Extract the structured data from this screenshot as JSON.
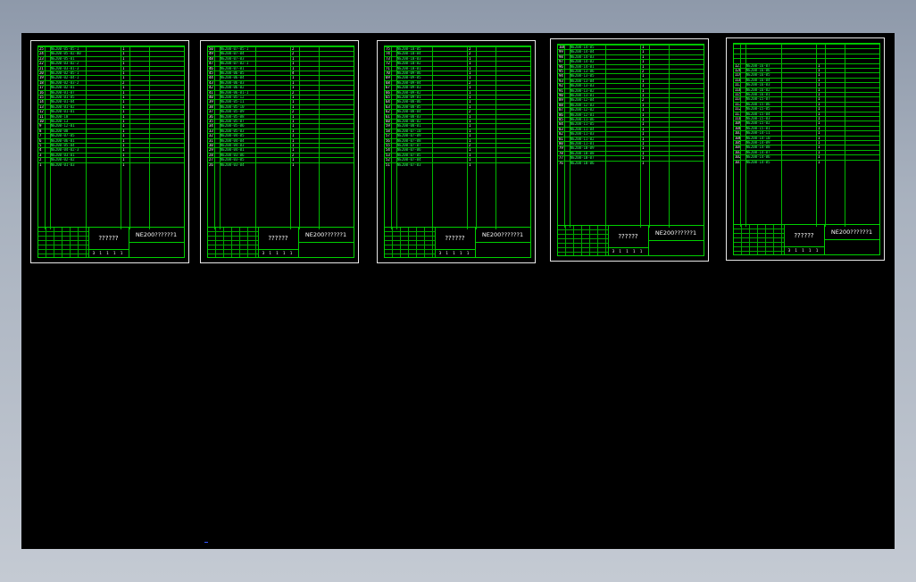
{
  "colors": {
    "background_top": "#8e99aa",
    "background_bottom": "#c4cad3",
    "model_space": "#000000",
    "sheet_border": "#e8e8e8",
    "frame_line": "#00d000",
    "text_code": "#33ff66",
    "text_name": "#2f9fff",
    "text_plain": "#ffffff"
  },
  "sheets": [
    {
      "center_label": "??????",
      "drawing_code": "NE200??????1",
      "bottom_marks": "3 1 1 1 1",
      "rows": [
        [
          "25",
          "",
          "NE200-05-05-1",
          "",
          "1",
          "",
          "",
          ""
        ],
        [
          "24",
          "",
          "NE200-05-02-00",
          "",
          "1",
          "",
          "",
          ""
        ],
        [
          "23",
          "",
          "NE200-05-01",
          "",
          "1",
          "",
          "",
          ""
        ],
        [
          "22",
          "",
          "NE200-03-02-2",
          "",
          "1",
          "",
          "",
          ""
        ],
        [
          "21",
          "",
          "NE200-03-01-3",
          "",
          "1",
          "",
          "",
          ""
        ],
        [
          "20",
          "",
          "NE200-02-05-1",
          "",
          "1",
          "",
          "",
          ""
        ],
        [
          "19",
          "",
          "NE200-02-04-1",
          "",
          "1",
          "",
          "",
          ""
        ],
        [
          "18",
          "",
          "NE200-02-03-2",
          "",
          "2",
          "",
          "",
          ""
        ],
        [
          "17",
          "",
          "NE200-02-01",
          "",
          "1",
          "",
          "",
          ""
        ],
        [
          "16",
          "",
          "NE200-01-07",
          "",
          "1",
          "",
          "",
          ""
        ],
        [
          "15",
          "",
          "NE200-01-05",
          "",
          "1",
          "",
          "",
          ""
        ],
        [
          "14",
          "",
          "NE200-01-04",
          "",
          "1",
          "",
          "",
          ""
        ],
        [
          "13",
          "",
          "NE200-01-02",
          "",
          "1",
          "",
          "",
          ""
        ],
        [
          "12",
          "",
          "NE200-01-01",
          "",
          "1",
          "",
          "",
          ""
        ],
        [
          "11",
          "",
          "NE200-18",
          "",
          "1",
          "",
          "",
          ""
        ],
        [
          "10",
          "",
          "NE200-13",
          "",
          "1",
          "",
          "",
          ""
        ],
        [
          "9",
          "",
          "NE200-12-01",
          "",
          "1",
          "",
          "",
          ""
        ],
        [
          "8",
          "",
          "NE200-08",
          "",
          "1",
          "",
          "",
          ""
        ],
        [
          "7",
          "",
          "NE200-07-05",
          "",
          "1",
          "",
          "",
          ""
        ],
        [
          "6",
          "",
          "NE200-06-01",
          "",
          "1",
          "",
          "",
          ""
        ],
        [
          "5",
          "",
          "NE200-05-04",
          "",
          "1",
          "",
          "",
          ""
        ],
        [
          "4",
          "",
          "NE200-04-02-3",
          "",
          "1",
          "",
          "",
          ""
        ],
        [
          "3",
          "",
          "NE200-03-01",
          "",
          "1",
          "",
          "",
          ""
        ],
        [
          "2",
          "",
          "NE200-02-02",
          "",
          "1",
          "",
          "",
          ""
        ],
        [
          "1",
          "",
          "NE200-01-03",
          "",
          "1",
          "",
          "",
          ""
        ]
      ]
    },
    {
      "center_label": "??????",
      "drawing_code": "NE200??????1",
      "bottom_marks": "3 1 1 1 1",
      "rows": [
        [
          "50",
          "",
          "NE200-07-05-1",
          "",
          "2",
          "",
          "",
          ""
        ],
        [
          "49",
          "",
          "NE200-07-04",
          "",
          "2",
          "",
          "",
          ""
        ],
        [
          "48",
          "",
          "NE200-07-03",
          "",
          "1",
          "",
          "",
          ""
        ],
        [
          "47",
          "",
          "NE200-07-02-1",
          "",
          "1",
          "",
          "",
          ""
        ],
        [
          "46",
          "",
          "NE200-07-01",
          "",
          "1",
          "",
          "",
          ""
        ],
        [
          "45",
          "",
          "NE200-06-05",
          "",
          "4",
          "",
          "",
          ""
        ],
        [
          "44",
          "",
          "NE200-06-04",
          "",
          "1",
          "",
          "",
          ""
        ],
        [
          "43",
          "",
          "NE200-06-03",
          "",
          "1",
          "",
          "",
          ""
        ],
        [
          "42",
          "",
          "NE200-06-02",
          "",
          "1",
          "",
          "",
          ""
        ],
        [
          "41",
          "",
          "NE200-06-01-1",
          "",
          "2",
          "",
          "",
          ""
        ],
        [
          "40",
          "",
          "NE200-05-12",
          "",
          "1",
          "",
          "",
          ""
        ],
        [
          "39",
          "",
          "NE200-05-11",
          "",
          "1",
          "",
          "",
          ""
        ],
        [
          "38",
          "",
          "NE200-05-10",
          "",
          "1",
          "",
          "",
          ""
        ],
        [
          "37",
          "",
          "NE200-05-09",
          "",
          "2",
          "",
          "",
          ""
        ],
        [
          "36",
          "",
          "NE200-05-08",
          "",
          "1",
          "",
          "",
          ""
        ],
        [
          "35",
          "",
          "NE200-05-07",
          "",
          "1",
          "",
          "",
          ""
        ],
        [
          "34",
          "",
          "NE200-05-06",
          "",
          "1",
          "",
          "",
          ""
        ],
        [
          "33",
          "",
          "NE200-05-03",
          "",
          "1",
          "",
          "",
          ""
        ],
        [
          "32",
          "",
          "NE200-04-05",
          "",
          "1",
          "",
          "",
          ""
        ],
        [
          "31",
          "",
          "NE200-04-04",
          "",
          "1",
          "",
          "",
          ""
        ],
        [
          "30",
          "",
          "NE200-04-03",
          "",
          "1",
          "",
          "",
          ""
        ],
        [
          "29",
          "",
          "NE200-04-01",
          "",
          "1",
          "",
          "",
          ""
        ],
        [
          "28",
          "",
          "NE200-03-06",
          "",
          "2",
          "",
          "",
          ""
        ],
        [
          "27",
          "",
          "NE200-03-05",
          "",
          "1",
          "",
          "",
          ""
        ],
        [
          "26",
          "",
          "NE200-03-04",
          "",
          "1",
          "",
          "",
          ""
        ]
      ]
    },
    {
      "center_label": "??????",
      "drawing_code": "NE200??????1",
      "bottom_marks": "3 1 1 1 1",
      "rows": [
        [
          "75",
          "",
          "NE200-10-05",
          "",
          "2",
          "",
          "",
          ""
        ],
        [
          "74",
          "",
          "NE200-10-04",
          "",
          "2",
          "",
          "",
          ""
        ],
        [
          "73",
          "",
          "NE200-10-03",
          "",
          "1",
          "",
          "",
          ""
        ],
        [
          "72",
          "",
          "NE200-10-02",
          "",
          "1",
          "",
          "",
          ""
        ],
        [
          "71",
          "",
          "NE200-10-01",
          "",
          "1",
          "",
          "",
          ""
        ],
        [
          "70",
          "",
          "NE200-09-06",
          "",
          "1",
          "",
          "",
          ""
        ],
        [
          "69",
          "",
          "NE200-09-05",
          "",
          "1",
          "",
          "",
          ""
        ],
        [
          "68",
          "",
          "NE200-09-04",
          "",
          "2",
          "",
          "",
          ""
        ],
        [
          "67",
          "",
          "NE200-09-03",
          "",
          "1",
          "",
          "",
          ""
        ],
        [
          "66",
          "",
          "NE200-09-02",
          "",
          "1",
          "",
          "",
          ""
        ],
        [
          "65",
          "",
          "NE200-09-01",
          "",
          "1",
          "",
          "",
          ""
        ],
        [
          "64",
          "",
          "NE200-08-06",
          "",
          "1",
          "",
          "",
          ""
        ],
        [
          "63",
          "",
          "NE200-08-05",
          "",
          "1",
          "",
          "",
          ""
        ],
        [
          "62",
          "",
          "NE200-08-04",
          "",
          "2",
          "",
          "",
          ""
        ],
        [
          "61",
          "",
          "NE200-08-03",
          "",
          "1",
          "",
          "",
          ""
        ],
        [
          "60",
          "",
          "NE200-08-02",
          "",
          "1",
          "",
          "",
          ""
        ],
        [
          "59",
          "",
          "NE200-08-01",
          "",
          "1",
          "",
          "",
          ""
        ],
        [
          "58",
          "",
          "NE200-07-10",
          "",
          "1",
          "",
          "",
          ""
        ],
        [
          "57",
          "",
          "NE200-07-09",
          "",
          "1",
          "",
          "",
          ""
        ],
        [
          "56",
          "",
          "NE200-07-08",
          "",
          "1",
          "",
          "",
          ""
        ],
        [
          "55",
          "",
          "NE200-07-07",
          "",
          "2",
          "",
          "",
          ""
        ],
        [
          "54",
          "",
          "NE200-07-06",
          "",
          "1",
          "",
          "",
          ""
        ],
        [
          "53",
          "",
          "NE200-07-05",
          "",
          "1",
          "",
          "",
          ""
        ],
        [
          "52",
          "",
          "NE200-07-04",
          "",
          "1",
          "",
          "",
          ""
        ],
        [
          "51",
          "",
          "NE200-07-03",
          "",
          "1",
          "",
          "",
          ""
        ]
      ]
    },
    {
      "center_label": "??????",
      "drawing_code": "NE200??????1",
      "bottom_marks": "3 1 1 1 1",
      "rows": [
        [
          "100",
          "",
          "NE200-14-05",
          "",
          "1",
          "",
          "",
          ""
        ],
        [
          "99",
          "",
          "NE200-14-04",
          "",
          "1",
          "",
          "",
          ""
        ],
        [
          "98",
          "",
          "NE200-14-03",
          "",
          "1",
          "",
          "",
          ""
        ],
        [
          "97",
          "",
          "NE200-14-02",
          "",
          "1",
          "",
          "",
          ""
        ],
        [
          "96",
          "",
          "NE200-14-01",
          "",
          "1",
          "",
          "",
          ""
        ],
        [
          "95",
          "",
          "NE200-13-06",
          "",
          "2",
          "",
          "",
          ""
        ],
        [
          "94",
          "",
          "NE200-13-05",
          "",
          "1",
          "",
          "",
          ""
        ],
        [
          "93",
          "",
          "NE200-13-04",
          "",
          "1",
          "",
          "",
          ""
        ],
        [
          "92",
          "",
          "NE200-13-03",
          "",
          "1",
          "",
          "",
          ""
        ],
        [
          "91",
          "",
          "NE200-13-02",
          "",
          "1",
          "",
          "",
          ""
        ],
        [
          "90",
          "",
          "NE200-13-01",
          "",
          "1",
          "",
          "",
          ""
        ],
        [
          "89",
          "",
          "NE200-12-04",
          "",
          "2",
          "",
          "",
          ""
        ],
        [
          "88",
          "",
          "NE200-12-03",
          "",
          "1",
          "",
          "",
          ""
        ],
        [
          "87",
          "",
          "NE200-12-02",
          "",
          "1",
          "",
          "",
          ""
        ],
        [
          "86",
          "",
          "NE200-12-01",
          "",
          "1",
          "",
          "",
          ""
        ],
        [
          "85",
          "",
          "NE200-11-06",
          "",
          "1",
          "",
          "",
          ""
        ],
        [
          "84",
          "",
          "NE200-11-05",
          "",
          "1",
          "",
          "",
          ""
        ],
        [
          "83",
          "",
          "NE200-11-04",
          "",
          "1",
          "",
          "",
          ""
        ],
        [
          "82",
          "",
          "NE200-11-03",
          "",
          "1",
          "",
          "",
          ""
        ],
        [
          "81",
          "",
          "NE200-11-02",
          "",
          "1",
          "",
          "",
          ""
        ],
        [
          "80",
          "",
          "NE200-11-01",
          "",
          "1",
          "",
          "",
          ""
        ],
        [
          "79",
          "",
          "NE200-10-09",
          "",
          "1",
          "",
          "",
          ""
        ],
        [
          "78",
          "",
          "NE200-10-08",
          "",
          "1",
          "",
          "",
          ""
        ],
        [
          "77",
          "",
          "NE200-10-07",
          "",
          "1",
          "",
          "",
          ""
        ],
        [
          "76",
          "",
          "NE200-10-06",
          "",
          "1",
          "",
          "",
          ""
        ]
      ]
    },
    {
      "center_label": "??????",
      "drawing_code": "NE200??????1",
      "bottom_marks": "3 1 1 1 1",
      "rows": [
        [
          "",
          "",
          "",
          "",
          "",
          "",
          "",
          ""
        ],
        [
          "",
          "",
          "",
          "",
          "",
          "",
          "",
          ""
        ],
        [
          "",
          "",
          "",
          "",
          "",
          "",
          "",
          ""
        ],
        [
          "",
          "",
          "",
          "",
          "",
          "",
          "",
          ""
        ],
        [
          "121",
          "",
          "NE200-16-07",
          "",
          "1",
          "",
          "",
          ""
        ],
        [
          "120",
          "",
          "NE200-16-06",
          "",
          "1",
          "",
          "",
          ""
        ],
        [
          "119",
          "",
          "NE200-16-05",
          "",
          "1",
          "",
          "",
          ""
        ],
        [
          "118",
          "",
          "NE200-16-04",
          "",
          "1",
          "",
          "",
          ""
        ],
        [
          "117",
          "",
          "NE200-16-03",
          "",
          "1",
          "",
          "",
          ""
        ],
        [
          "116",
          "",
          "NE200-16-02",
          "",
          "1",
          "",
          "",
          ""
        ],
        [
          "115",
          "",
          "NE200-16-01",
          "",
          "1",
          "",
          "",
          ""
        ],
        [
          "114",
          "",
          "NE200-15-07",
          "",
          "1",
          "",
          "",
          ""
        ],
        [
          "113",
          "",
          "NE200-15-06",
          "",
          "1",
          "",
          "",
          ""
        ],
        [
          "112",
          "",
          "NE200-15-05",
          "",
          "1",
          "",
          "",
          ""
        ],
        [
          "111",
          "",
          "NE200-15-04",
          "",
          "1",
          "",
          "",
          ""
        ],
        [
          "110",
          "",
          "NE200-15-03",
          "",
          "1",
          "",
          "",
          ""
        ],
        [
          "109",
          "",
          "NE200-15-02",
          "",
          "1",
          "",
          "",
          ""
        ],
        [
          "108",
          "",
          "NE200-15-01",
          "",
          "1",
          "",
          "",
          ""
        ],
        [
          "107",
          "",
          "NE200-14-11",
          "",
          "1",
          "",
          "",
          ""
        ],
        [
          "106",
          "",
          "NE200-14-10",
          "",
          "1",
          "",
          "",
          ""
        ],
        [
          "105",
          "",
          "NE200-14-09",
          "",
          "1",
          "",
          "",
          ""
        ],
        [
          "104",
          "",
          "NE200-14-08",
          "",
          "1",
          "",
          "",
          ""
        ],
        [
          "103",
          "",
          "NE200-14-07",
          "",
          "1",
          "",
          "",
          ""
        ],
        [
          "102",
          "",
          "NE200-14-06",
          "",
          "1",
          "",
          "",
          ""
        ],
        [
          "101",
          "",
          "NE200-14-05",
          "",
          "1",
          "",
          "",
          ""
        ]
      ]
    }
  ]
}
